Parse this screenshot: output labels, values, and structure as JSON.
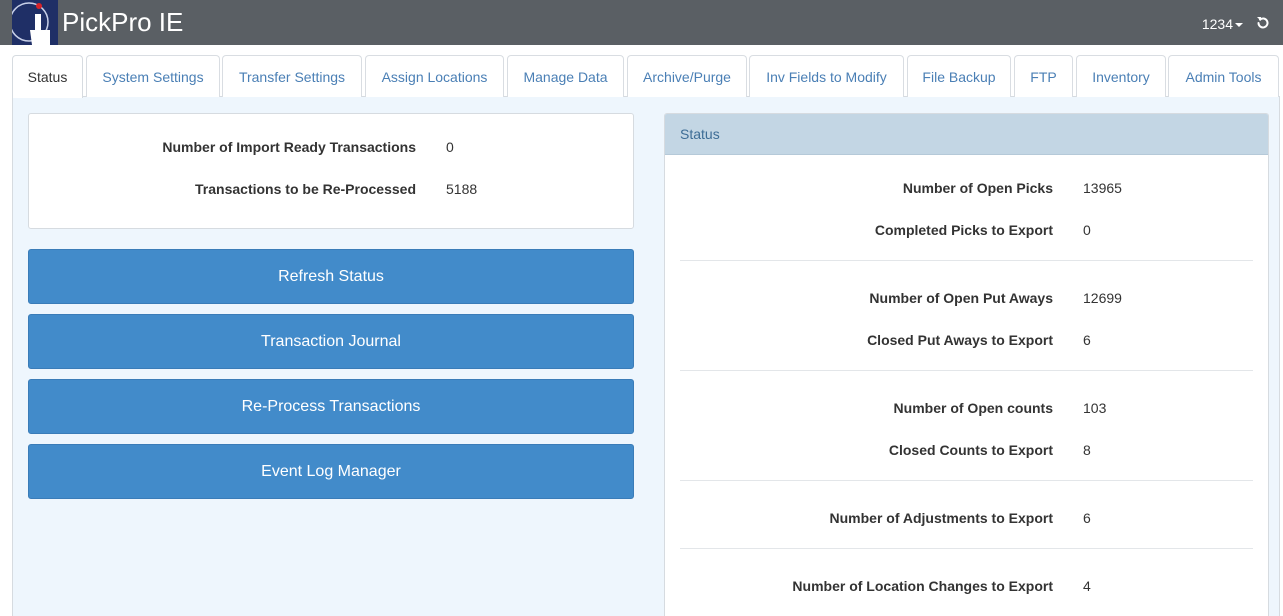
{
  "app": {
    "title": "PickPro IE",
    "user": "1234",
    "logo_icon": "pickpro-logo-icon",
    "reload_icon": "reload-icon"
  },
  "tabs": [
    {
      "label": "Status",
      "active": true
    },
    {
      "label": "System Settings"
    },
    {
      "label": "Transfer Settings"
    },
    {
      "label": "Assign Locations"
    },
    {
      "label": "Manage Data"
    },
    {
      "label": "Archive/Purge"
    },
    {
      "label": "Inv Fields to Modify"
    },
    {
      "label": "File Backup"
    },
    {
      "label": "FTP"
    },
    {
      "label": "Inventory"
    },
    {
      "label": "Admin Tools"
    }
  ],
  "import": {
    "rows": [
      {
        "label": "Number of Import Ready Transactions",
        "value": "0"
      },
      {
        "label": "Transactions to be Re-Processed",
        "value": "5188"
      }
    ]
  },
  "actions": [
    {
      "label": "Refresh Status"
    },
    {
      "label": "Transaction Journal"
    },
    {
      "label": "Re-Process Transactions"
    },
    {
      "label": "Event Log Manager"
    }
  ],
  "status": {
    "heading": "Status",
    "rows": [
      {
        "label": "Number of Open Picks",
        "value": "13965"
      },
      {
        "label": "Completed Picks to Export",
        "value": "0"
      },
      {
        "label": "Number of Open Put Aways",
        "value": "12699"
      },
      {
        "label": "Closed Put Aways to Export",
        "value": "6"
      },
      {
        "label": "Number of Open counts",
        "value": "103"
      },
      {
        "label": "Closed Counts to Export",
        "value": "8"
      },
      {
        "label": "Number of Adjustments to Export",
        "value": "6"
      },
      {
        "label": "Number of Location Changes to Export",
        "value": "4"
      }
    ]
  },
  "colors": {
    "topbar": "#5a5f64",
    "accent_button": "#428bca",
    "status_header": "#c3d6e4",
    "content_bg": "#eef6fd"
  }
}
